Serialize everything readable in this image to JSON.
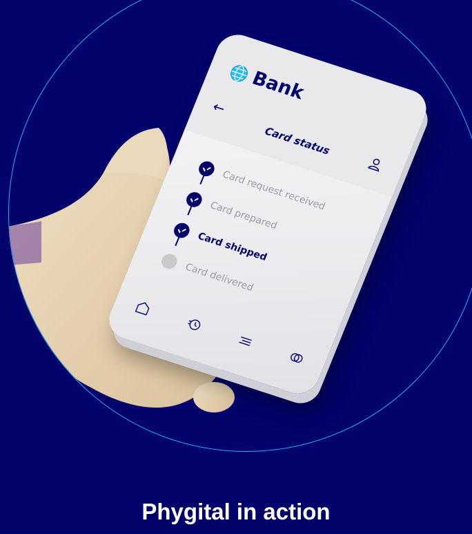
{
  "app": {
    "brand_name": "Bank",
    "screen_title": "Card status"
  },
  "steps": [
    {
      "label": "Card request received",
      "state": "done"
    },
    {
      "label": "Card prepared",
      "state": "done"
    },
    {
      "label": "Card shipped",
      "state": "current"
    },
    {
      "label": "Card delivered",
      "state": "pending"
    }
  ],
  "bottom_nav": [
    {
      "icon": "home-icon"
    },
    {
      "icon": "history-icon"
    },
    {
      "icon": "menu-icon"
    },
    {
      "icon": "link-icon"
    }
  ],
  "headline": "Phygital in action",
  "colors": {
    "background": "#02036b",
    "circle_outline": "#1fb6ef",
    "primary": "#02036b",
    "text": "#ffffff"
  }
}
